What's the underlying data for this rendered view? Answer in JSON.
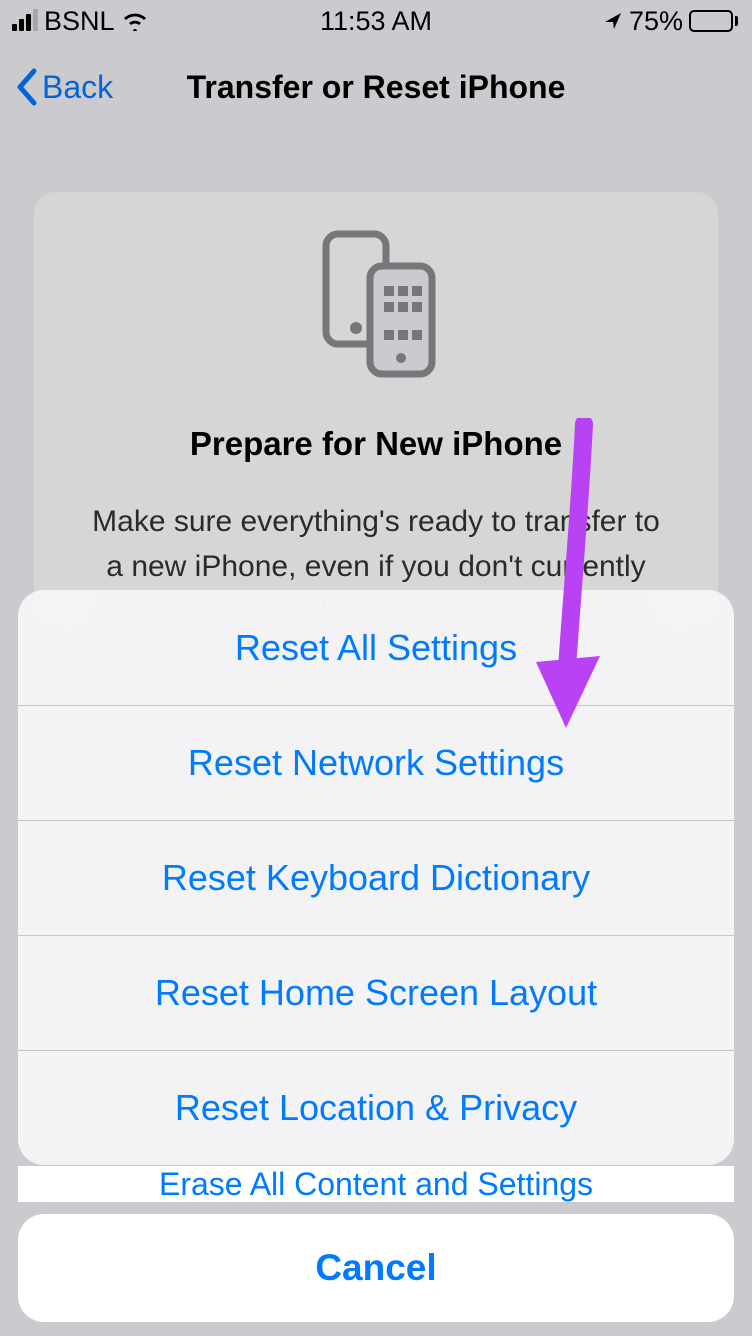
{
  "status_bar": {
    "carrier": "BSNL",
    "time": "11:53 AM",
    "battery_percent": "75%"
  },
  "nav": {
    "back_label": "Back",
    "title": "Transfer or Reset iPhone"
  },
  "card": {
    "title": "Prepare for New iPhone",
    "body": "Make sure everything's ready to transfer to a new iPhone, even if you don't currently have enough iCloud storage to back up."
  },
  "action_sheet": {
    "items": [
      "Reset All Settings",
      "Reset Network Settings",
      "Reset Keyboard Dictionary",
      "Reset Home Screen Layout",
      "Reset Location & Privacy"
    ],
    "erase_row": "Erase All Content and Settings",
    "cancel": "Cancel"
  },
  "annotation": {
    "arrow_color": "#b942f5"
  }
}
